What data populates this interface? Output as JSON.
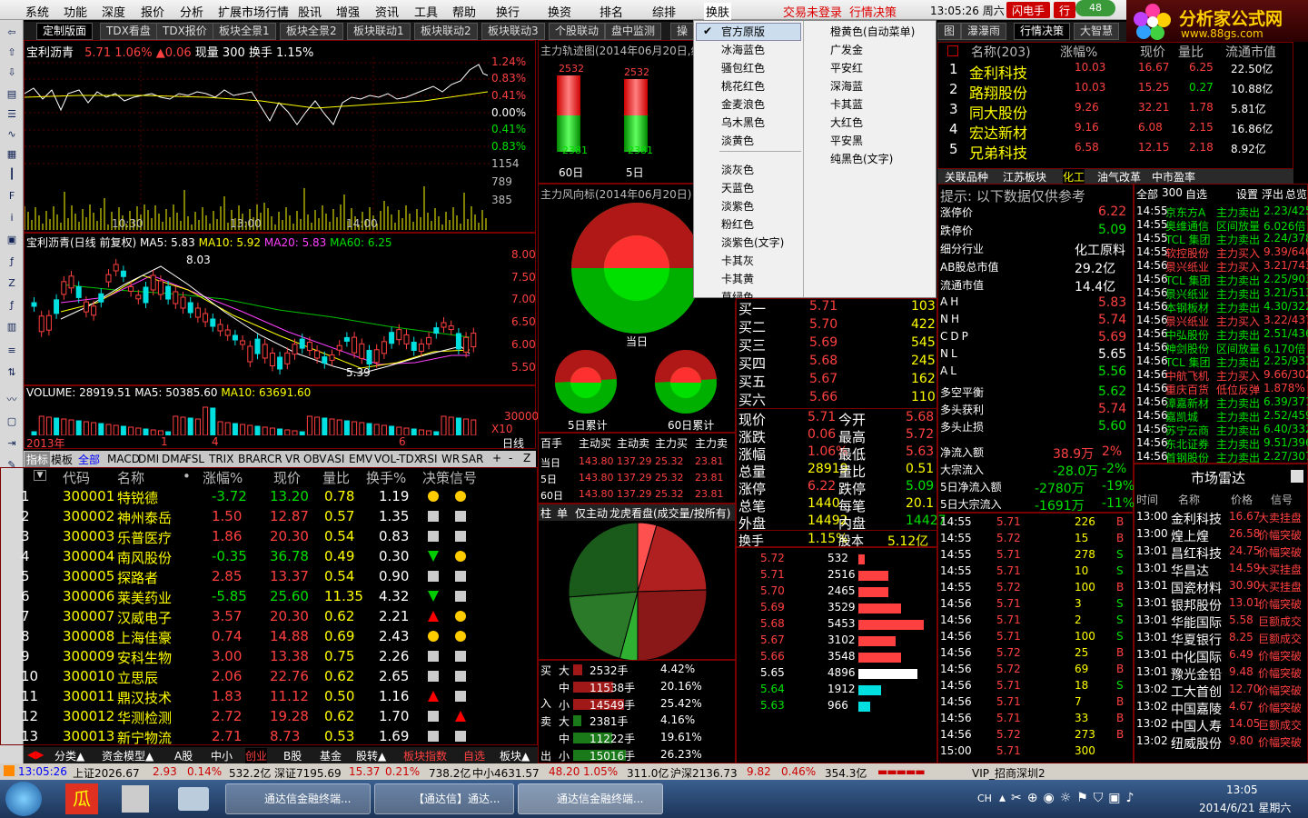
{
  "menu": {
    "items": [
      "系统",
      "功能",
      "深度",
      "报价",
      "分析",
      "扩展市场行情",
      "股讯",
      "增强",
      "资讯",
      "工具",
      "帮助",
      "换行",
      "换资",
      "排名",
      "综排",
      "换肤"
    ],
    "login": "交易未登录",
    "decision": "行情决策",
    "clock": "13:05:26 周六",
    "flash": "闪电手",
    "hang": "行",
    "badge": "48"
  },
  "logo": {
    "title": "分析家公式网",
    "url": "www.88gs.com"
  },
  "tabs": [
    "定制版面",
    "TDX看盘",
    "TDX报价",
    "板块全景1",
    "板块全景2",
    "板块联动1",
    "板块联动2",
    "板块联动3",
    "个股联动",
    "盘中监测",
    "操"
  ],
  "intraday": {
    "name": "宝利沥青",
    "price": "5.71",
    "pct": "1.06%",
    "chg": "▲0.06",
    "vol": "现量 300",
    "turn": "换手 1.15%",
    "rlabels": [
      "1.24%",
      "0.83%",
      "0.41%",
      "0.00%",
      "0.41%",
      "0.83%",
      "1154",
      "789",
      "385"
    ],
    "times": [
      "10:30",
      "13:00",
      "14:00"
    ]
  },
  "kline": {
    "title": "宝利沥青(日线 前复权)",
    "ma5": "MA5: 5.83",
    "ma10": "MA10: 5.92",
    "ma20": "MA20: 5.83",
    "ma60": "MA60: 6.25",
    "rlabels": [
      "8.00",
      "7.50",
      "7.00",
      "6.50",
      "6.00",
      "5.50"
    ],
    "hi": "8.03",
    "lo": "5.39"
  },
  "volume": {
    "text": "VOLUME: 28919.51",
    "ma5": "MA5: 50385.60",
    "ma10": "MA10: 63691.60",
    "r1": "30000",
    "r2": "X10",
    "years": [
      "2013年",
      "1",
      "4",
      "6"
    ]
  },
  "indbar": [
    "指标",
    "模板",
    "全部",
    "MACD",
    "DMI",
    "DMA",
    "FSL",
    "TRIX",
    "BRAR",
    "CR",
    "VR",
    "OBV",
    "ASI",
    "EMV",
    "VOL-TDX",
    "RSI",
    "WR",
    "SAR",
    "+",
    "-",
    "Z"
  ],
  "daily": "日线",
  "table": {
    "headers": [
      "代码",
      "名称",
      "•",
      "涨幅%",
      "现价",
      "量比",
      "换手%",
      "决策信号"
    ],
    "rows": [
      [
        "1",
        "300001",
        "特锐德",
        "-3.72",
        "13.20",
        "0.78",
        "1.19",
        "dd"
      ],
      [
        "2",
        "300002",
        "神州泰岳",
        "1.50",
        "12.87",
        "0.57",
        "1.35",
        "ss"
      ],
      [
        "3",
        "300003",
        "乐普医疗",
        "1.86",
        "20.30",
        "0.54",
        "0.83",
        "ss"
      ],
      [
        "4",
        "300004",
        "南风股份",
        "-0.35",
        "36.78",
        "0.49",
        "0.30",
        "vd"
      ],
      [
        "5",
        "300005",
        "探路者",
        "2.85",
        "13.37",
        "0.54",
        "0.90",
        "ss"
      ],
      [
        "6",
        "300006",
        "莱美药业",
        "-5.85",
        "25.60",
        "11.35",
        "4.32",
        "vs"
      ],
      [
        "7",
        "300007",
        "汉威电子",
        "3.57",
        "20.30",
        "0.62",
        "2.21",
        "ud"
      ],
      [
        "8",
        "300008",
        "上海佳豪",
        "0.74",
        "14.88",
        "0.69",
        "2.43",
        "dd"
      ],
      [
        "9",
        "300009",
        "安科生物",
        "3.00",
        "13.38",
        "0.75",
        "2.26",
        "ss"
      ],
      [
        "10",
        "300010",
        "立思辰",
        "2.06",
        "22.76",
        "0.62",
        "2.65",
        "ss"
      ],
      [
        "11",
        "300011",
        "鼎汉技术",
        "1.83",
        "11.12",
        "0.50",
        "1.16",
        "us"
      ],
      [
        "12",
        "300012",
        "华测检测",
        "2.72",
        "19.28",
        "0.62",
        "1.70",
        "su"
      ],
      [
        "13",
        "300013",
        "新宁物流",
        "2.71",
        "8.73",
        "0.53",
        "1.69",
        "ss"
      ]
    ]
  },
  "bottomtabs": [
    "分类▲",
    "资金模型▲",
    "A股",
    "中小",
    "创业",
    "B股",
    "基金",
    "股转▲",
    "板块指数",
    "自选",
    "板块▲"
  ],
  "mainflow": {
    "title": "主力轨迹图(2014年06月20日,统",
    "b1": "2532",
    "b2": "2532",
    "n1": "-2381",
    "n2": "-2381",
    "l1": "60日",
    "l2": "5日"
  },
  "wind": {
    "title": "主力风向标(2014年06月20日)",
    "c1": "当日",
    "c2": "5日累计",
    "c3": "60日累计"
  },
  "flowtable": {
    "headers": [
      "百手",
      "主动买",
      "主动卖",
      "主力买",
      "主力卖"
    ],
    "rows": [
      [
        "当日",
        "143.80",
        "137.29",
        "25.32",
        "23.81"
      ],
      [
        "5日",
        "143.80",
        "137.29",
        "25.32",
        "23.81"
      ],
      [
        "60日",
        "143.80",
        "137.29",
        "25.32",
        "23.81"
      ]
    ]
  },
  "pietabs": [
    "柱",
    "单",
    "仅主动",
    "龙虎看盘(成交量/按所有)"
  ],
  "buysell": {
    "buy": [
      [
        "大",
        "2532手",
        "4.42%"
      ],
      [
        "中",
        "11538手",
        "20.16%"
      ],
      [
        "小",
        "14549手",
        "25.42%"
      ]
    ],
    "sell": [
      [
        "大",
        "2381手",
        "4.16%"
      ],
      [
        "中",
        "11222手",
        "19.61%"
      ],
      [
        "小",
        "15016手",
        "26.23%"
      ]
    ],
    "bl": [
      "买",
      "入"
    ],
    "sl": [
      "卖",
      "出"
    ]
  },
  "dropdown": {
    "left": [
      "官方原版",
      "冰海蓝色",
      "骚包红色",
      "桃花红色",
      "金麦浪色",
      "乌木黑色",
      "淡黄色",
      "淡灰色",
      "天蓝色",
      "淡紫色",
      "粉红色",
      "淡紫色(文字)",
      "卡其灰",
      "卡其黄",
      "草绿色"
    ],
    "right": [
      "橙黄色(自动菜单)",
      "广发金",
      "平安红",
      "深海蓝",
      "卡其蓝",
      "大红色",
      "平安黑",
      "纯黑色(文字)"
    ]
  },
  "orderbook": {
    "buys": [
      [
        "买一",
        "5.71",
        "103"
      ],
      [
        "买二",
        "5.70",
        "422"
      ],
      [
        "买三",
        "5.69",
        "545"
      ],
      [
        "买四",
        "5.68",
        "245"
      ],
      [
        "买五",
        "5.67",
        "162"
      ],
      [
        "买六",
        "5.66",
        "110"
      ]
    ],
    "info": [
      [
        "现价",
        "5.71",
        "今开",
        "5.68"
      ],
      [
        "涨跌",
        "0.06",
        "最高",
        "5.72"
      ],
      [
        "涨幅",
        "1.06%",
        "最低",
        "5.63"
      ],
      [
        "总量",
        "28919",
        "量比",
        "0.51"
      ],
      [
        "涨停",
        "6.22",
        "跌停",
        "5.09"
      ],
      [
        "总笔",
        "1440",
        "每笔",
        "20.1"
      ],
      [
        "外盘",
        "14492",
        "内盘",
        "14427"
      ]
    ],
    "turn": [
      "换手",
      "1.15%",
      "股本",
      "5.12亿"
    ]
  },
  "depth": [
    [
      "5.72",
      "532"
    ],
    [
      "5.71",
      "2516"
    ],
    [
      "5.70",
      "2465"
    ],
    [
      "5.69",
      "3529"
    ],
    [
      "5.68",
      "5453"
    ],
    [
      "5.67",
      "3102"
    ],
    [
      "5.66",
      "3548"
    ],
    [
      "5.65",
      "4896"
    ],
    [
      "5.64",
      "1912"
    ],
    [
      "5.63",
      "966"
    ]
  ],
  "ranking": {
    "tabs": [
      "图",
      "瀑瀑雨",
      "行情决策",
      "大智慧"
    ],
    "headers": [
      "名称(203)",
      "涨幅%",
      "现价",
      "量比",
      "流通市值"
    ],
    "rows": [
      [
        "1",
        "金利科技",
        "10.03",
        "16.67",
        "6.25",
        "22.50亿"
      ],
      [
        "2",
        "路翔股份",
        "10.03",
        "15.25",
        "0.27",
        "10.88亿"
      ],
      [
        "3",
        "同大股份",
        "9.26",
        "32.21",
        "1.78",
        "5.81亿"
      ],
      [
        "4",
        "宏达新材",
        "9.16",
        "6.08",
        "2.15",
        "16.86亿"
      ],
      [
        "5",
        "兄弟科技",
        "6.58",
        "12.15",
        "2.18",
        "8.92亿"
      ]
    ]
  },
  "sectors": [
    "关联品种",
    "江苏板块",
    "化工",
    "油气改革",
    "中市盈率"
  ],
  "hint": {
    "title": "提示: 以下数据仅供参考",
    "rows": [
      [
        "涨停价",
        "6.22"
      ],
      [
        "跌停价",
        "5.09"
      ],
      [
        "细分行业",
        "化工原料"
      ],
      [
        "AB股总市值",
        "29.2亿"
      ],
      [
        "流通市值",
        "14.4亿"
      ]
    ],
    "ah": [
      [
        "AH",
        "5.83"
      ],
      [
        "NH",
        "5.74"
      ],
      [
        "CDP",
        "5.69"
      ],
      [
        "NL",
        "5.65"
      ],
      [
        "AL",
        "5.56"
      ]
    ],
    "bal": [
      [
        "多空平衡",
        "5.62"
      ],
      [
        "多头获利",
        "5.74"
      ],
      [
        "多头止损",
        "5.60"
      ]
    ],
    "flow": [
      [
        "净流入额",
        "38.9万",
        "2%"
      ],
      [
        "大宗流入",
        "-28.0万",
        "-2%"
      ],
      [
        "5日净流入额",
        "-2780万",
        "-19%"
      ],
      [
        "5日大宗流入",
        "-1691万",
        "-11%"
      ]
    ]
  },
  "ticks": [
    [
      "14:55",
      "5.71",
      "226",
      "B"
    ],
    [
      "14:55",
      "5.72",
      "15",
      "B"
    ],
    [
      "14:55",
      "5.71",
      "278",
      "S"
    ],
    [
      "14:55",
      "5.71",
      "10",
      "S"
    ],
    [
      "14:55",
      "5.72",
      "100",
      "B"
    ],
    [
      "14:56",
      "5.71",
      "3",
      "S"
    ],
    [
      "14:56",
      "5.71",
      "2",
      "S"
    ],
    [
      "14:56",
      "5.71",
      "100",
      "S"
    ],
    [
      "14:56",
      "5.72",
      "25",
      "B"
    ],
    [
      "14:56",
      "5.72",
      "69",
      "B"
    ],
    [
      "14:56",
      "5.71",
      "18",
      "S"
    ],
    [
      "14:56",
      "5.71",
      "7",
      "B"
    ],
    [
      "14:56",
      "5.71",
      "33",
      "B"
    ],
    [
      "14:56",
      "5.72",
      "273",
      "B"
    ],
    [
      "15:00",
      "5.71",
      "300",
      ""
    ]
  ],
  "monitor": {
    "head": [
      "全部",
      "300",
      "自选",
      "设置",
      "浮出",
      "总览"
    ],
    "rows": [
      [
        "14:55",
        "京东方A",
        "主力卖出",
        "2.23/425"
      ],
      [
        "14:55",
        "奥维通信",
        "区间放量",
        "6.026倍"
      ],
      [
        "14:55",
        "TCL 集团",
        "主力卖出",
        "2.24/378"
      ],
      [
        "14:55",
        "软控股份",
        "主力买入",
        "9.39/646"
      ],
      [
        "14:56",
        "景兴纸业",
        "主力买入",
        "3.21/743"
      ],
      [
        "14:56",
        "TCL 集团",
        "主力卖出",
        "2.25/903"
      ],
      [
        "14:56",
        "景兴纸业",
        "主力卖出",
        "3.21/513"
      ],
      [
        "14:56",
        "本钢板材",
        "主力卖出",
        "4.30/322"
      ],
      [
        "14:56",
        "景兴纸业",
        "主力买入",
        "3.22/437"
      ],
      [
        "14:56",
        "中弘股份",
        "主力卖出",
        "2.51/436"
      ],
      [
        "14:56",
        "神剑股份",
        "区间放量",
        "6.170倍"
      ],
      [
        "14:56",
        "TCL 集团",
        "主力卖出",
        "2.25/931"
      ],
      [
        "14:56",
        "中航飞机",
        "主力买入",
        "9.66/302"
      ],
      [
        "14:56",
        "重庆百货",
        "低位反弹",
        "1.878%"
      ],
      [
        "14:56",
        "漳嘉新材",
        "主力卖出",
        "6.39/371"
      ],
      [
        "14:56",
        "嘉凯城",
        "主力卖出",
        "2.52/459"
      ],
      [
        "14:56",
        "苏宁云商",
        "主力卖出",
        "6.40/332"
      ],
      [
        "14:56",
        "东北证券",
        "主力卖出",
        "9.51/396"
      ],
      [
        "14:56",
        "首钢股份",
        "主力卖出",
        "2.27/307"
      ]
    ]
  },
  "radar": {
    "title": "市场雷达",
    "headers": [
      "时间",
      "名称",
      "价格",
      "信号"
    ],
    "rows": [
      [
        "13:00",
        "金利科技",
        "16.67",
        "大卖挂盘"
      ],
      [
        "13:00",
        "煌上煌",
        "26.58",
        "价幅突破"
      ],
      [
        "13:01",
        "昌红科技",
        "24.75",
        "价幅突破"
      ],
      [
        "13:01",
        "华昌达",
        "14.59",
        "大买挂盘"
      ],
      [
        "13:01",
        "国瓷材料",
        "30.90",
        "大买挂盘"
      ],
      [
        "13:01",
        "银邦股份",
        "13.01",
        "价幅突破"
      ],
      [
        "13:01",
        "华能国际",
        "5.58",
        "巨额成交"
      ],
      [
        "13:01",
        "华夏银行",
        "8.25",
        "巨额成交"
      ],
      [
        "13:01",
        "中化国际",
        "6.49",
        "价幅突破"
      ],
      [
        "13:01",
        "豫光金铅",
        "9.48",
        "价幅突破"
      ],
      [
        "13:02",
        "工大首创",
        "12.70",
        "价幅突破"
      ],
      [
        "13:02",
        "中国嘉陵",
        "4.67",
        "价幅突破"
      ],
      [
        "13:02",
        "中国人寿",
        "14.05",
        "巨额成交"
      ],
      [
        "13:02",
        "纽威股份",
        "9.80",
        "价幅突破"
      ]
    ]
  },
  "status": {
    "time": "13:05:26",
    "sh": "上证2026.67",
    "sh1": "2.93",
    "sh2": "0.14%",
    "sh3": "532.2亿",
    "sz": "深证7195.69",
    "sz1": "15.37",
    "sz2": "0.21%",
    "sz3": "738.2亿",
    "zx": "中小4631.57",
    "zx1": "48.20",
    "zx2": "1.05%",
    "zx3": "311.0亿",
    "hs": "沪深2136.73",
    "hs1": "9.82",
    "hs2": "0.46%",
    "hs3": "354.3亿",
    "vip": "VIP_招商深圳2"
  },
  "taskbar": {
    "items": [
      "通达信金融终端...",
      "【通达信】通达...",
      "通达信金融终端..."
    ],
    "ime": "CH",
    "time": "13:05",
    "date": "2014/6/21 星期六"
  },
  "colors": {
    "up": "#ff4040",
    "down": "#00e000",
    "bg": "#000000",
    "frame": "#7a0000"
  }
}
